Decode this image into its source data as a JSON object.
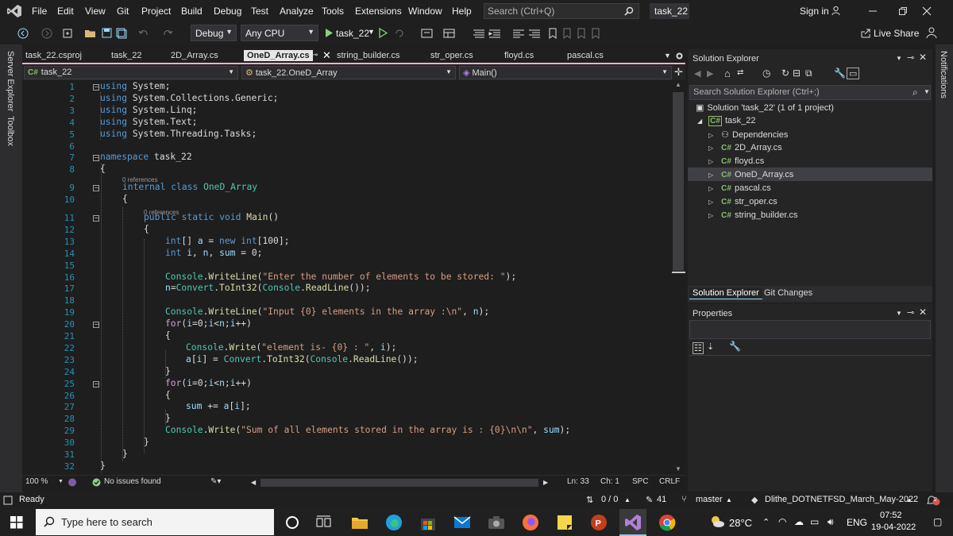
{
  "window": {
    "menu": [
      "File",
      "Edit",
      "View",
      "Git",
      "Project",
      "Build",
      "Debug",
      "Test",
      "Analyze",
      "Tools",
      "Extensions",
      "Window",
      "Help"
    ],
    "search_placeholder": "Search (Ctrl+Q)",
    "solution_tab": "task_22",
    "sign_in": "Sign in",
    "live_share": "Live Share"
  },
  "toolbar": {
    "config": "Debug",
    "platform": "Any CPU",
    "run_target": "task_22"
  },
  "left_strip": {
    "server_explorer": "Server Explorer",
    "toolbox": "Toolbox"
  },
  "right_strip": {
    "notifications": "Notifications"
  },
  "doc_tabs": [
    {
      "label": "task_22.csproj"
    },
    {
      "label": "task_22"
    },
    {
      "label": "2D_Array.cs"
    },
    {
      "label": "OneD_Array.cs",
      "active": true
    },
    {
      "label": "string_builder.cs"
    },
    {
      "label": "str_oper.cs"
    },
    {
      "label": "floyd.cs"
    },
    {
      "label": "pascal.cs"
    }
  ],
  "nav": {
    "project": "task_22",
    "class": "task_22.OneD_Array",
    "member": "Main()"
  },
  "editor": {
    "line_numbers": [
      "1",
      "2",
      "3",
      "4",
      "5",
      "6",
      "7",
      "8",
      "9",
      "10",
      "11",
      "12",
      "13",
      "14",
      "15",
      "16",
      "17",
      "18",
      "19",
      "20",
      "21",
      "22",
      "23",
      "24",
      "25",
      "26",
      "27",
      "28",
      "29",
      "30",
      "31",
      "32"
    ],
    "references": "0 references",
    "lines": {
      "l1": [
        "using",
        " System;"
      ],
      "l2": [
        "using",
        " System.Collections.Generic;"
      ],
      "l3": [
        "using",
        " System.Linq;"
      ],
      "l4": [
        "using",
        " System.Text;"
      ],
      "l5": [
        "using",
        " System.Threading.Tasks;"
      ],
      "l7": [
        "namespace",
        " task_22"
      ],
      "l8": [
        "{"
      ],
      "l9": [
        "internal",
        " ",
        "class",
        " ",
        "OneD_Array"
      ],
      "l10": [
        "{"
      ],
      "l11": [
        "public",
        " ",
        "static",
        " ",
        "void",
        " ",
        "Main",
        "()"
      ],
      "l12": [
        "{"
      ],
      "l13": [
        "int",
        "[] ",
        "a",
        " = ",
        "new",
        " ",
        "int",
        "[100];"
      ],
      "l14": [
        "int",
        " ",
        "i",
        ", ",
        "n",
        ", ",
        "sum",
        " = 0;"
      ],
      "l16": [
        "Console",
        ".",
        "WriteLine",
        "(",
        "\"Enter the number of elements to be stored: \"",
        ");"
      ],
      "l17": [
        "n",
        "=",
        "Convert",
        ".",
        "ToInt32",
        "(",
        "Console",
        ".",
        "ReadLine",
        "());"
      ],
      "l19": [
        "Console",
        ".",
        "WriteLine",
        "(",
        "\"Input {0} elements in the array :\\n\"",
        ", ",
        "n",
        ");"
      ],
      "l20": [
        "for",
        "(",
        "i",
        "=0;",
        "i",
        "<",
        "n",
        ";",
        "i",
        "++)"
      ],
      "l21": [
        "{"
      ],
      "l22": [
        "Console",
        ".",
        "Write",
        "(",
        "\"element is- {0} : \"",
        ", ",
        "i",
        ");"
      ],
      "l23": [
        "a",
        "[",
        "i",
        "] = ",
        "Convert",
        ".",
        "ToInt32",
        "(",
        "Console",
        ".",
        "ReadLine",
        "());"
      ],
      "l24": [
        "}"
      ],
      "l25": [
        "for",
        "(",
        "i",
        "=0;",
        "i",
        "<",
        "n",
        ";",
        "i",
        "++)"
      ],
      "l26": [
        "{"
      ],
      "l27": [
        "sum",
        " += ",
        "a",
        "[",
        "i",
        "];"
      ],
      "l28": [
        "}"
      ],
      "l29": [
        "Console",
        ".",
        "Write",
        "(",
        "\"Sum of all elements stored in the array is : {0}\\n\\n\"",
        ", ",
        "sum",
        ");"
      ],
      "l30": [
        "}"
      ],
      "l31": [
        "}"
      ],
      "l32": [
        "}"
      ]
    }
  },
  "editor_status": {
    "zoom": "100 %",
    "issues": "No issues found",
    "ln": "Ln: 33",
    "ch": "Ch: 1",
    "spc": "SPC",
    "crlf": "CRLF"
  },
  "solution_explorer": {
    "title": "Solution Explorer",
    "search_placeholder": "Search Solution Explorer (Ctrl+;)",
    "solution": "Solution 'task_22' (1 of 1 project)",
    "project": "task_22",
    "cs_badge": "C#",
    "items": [
      "Dependencies",
      "2D_Array.cs",
      "floyd.cs",
      "OneD_Array.cs",
      "pascal.cs",
      "str_oper.cs",
      "string_builder.cs"
    ]
  },
  "panel_tabs": {
    "solution_explorer": "Solution Explorer",
    "git_changes": "Git Changes"
  },
  "properties": {
    "title": "Properties"
  },
  "status": {
    "ready": "Ready",
    "changes": "0 / 0",
    "commits": "41",
    "branch": "master",
    "repo": "Dlithe_DOTNETFSD_March_May-2022",
    "notif_count": "2"
  },
  "taskbar": {
    "search_placeholder": "Type here to search",
    "temp": "28°C",
    "lang": "ENG",
    "time": "07:52",
    "date": "19-04-2022"
  },
  "colors": {
    "accent_vs": "#68217a",
    "tab_underline": "#f3b0d4",
    "keyword": "#569cd6",
    "type": "#4ec9b0",
    "string": "#d69d85",
    "method": "#dcdcaa",
    "control": "#d8a0df",
    "linenum": "#2b91af"
  }
}
